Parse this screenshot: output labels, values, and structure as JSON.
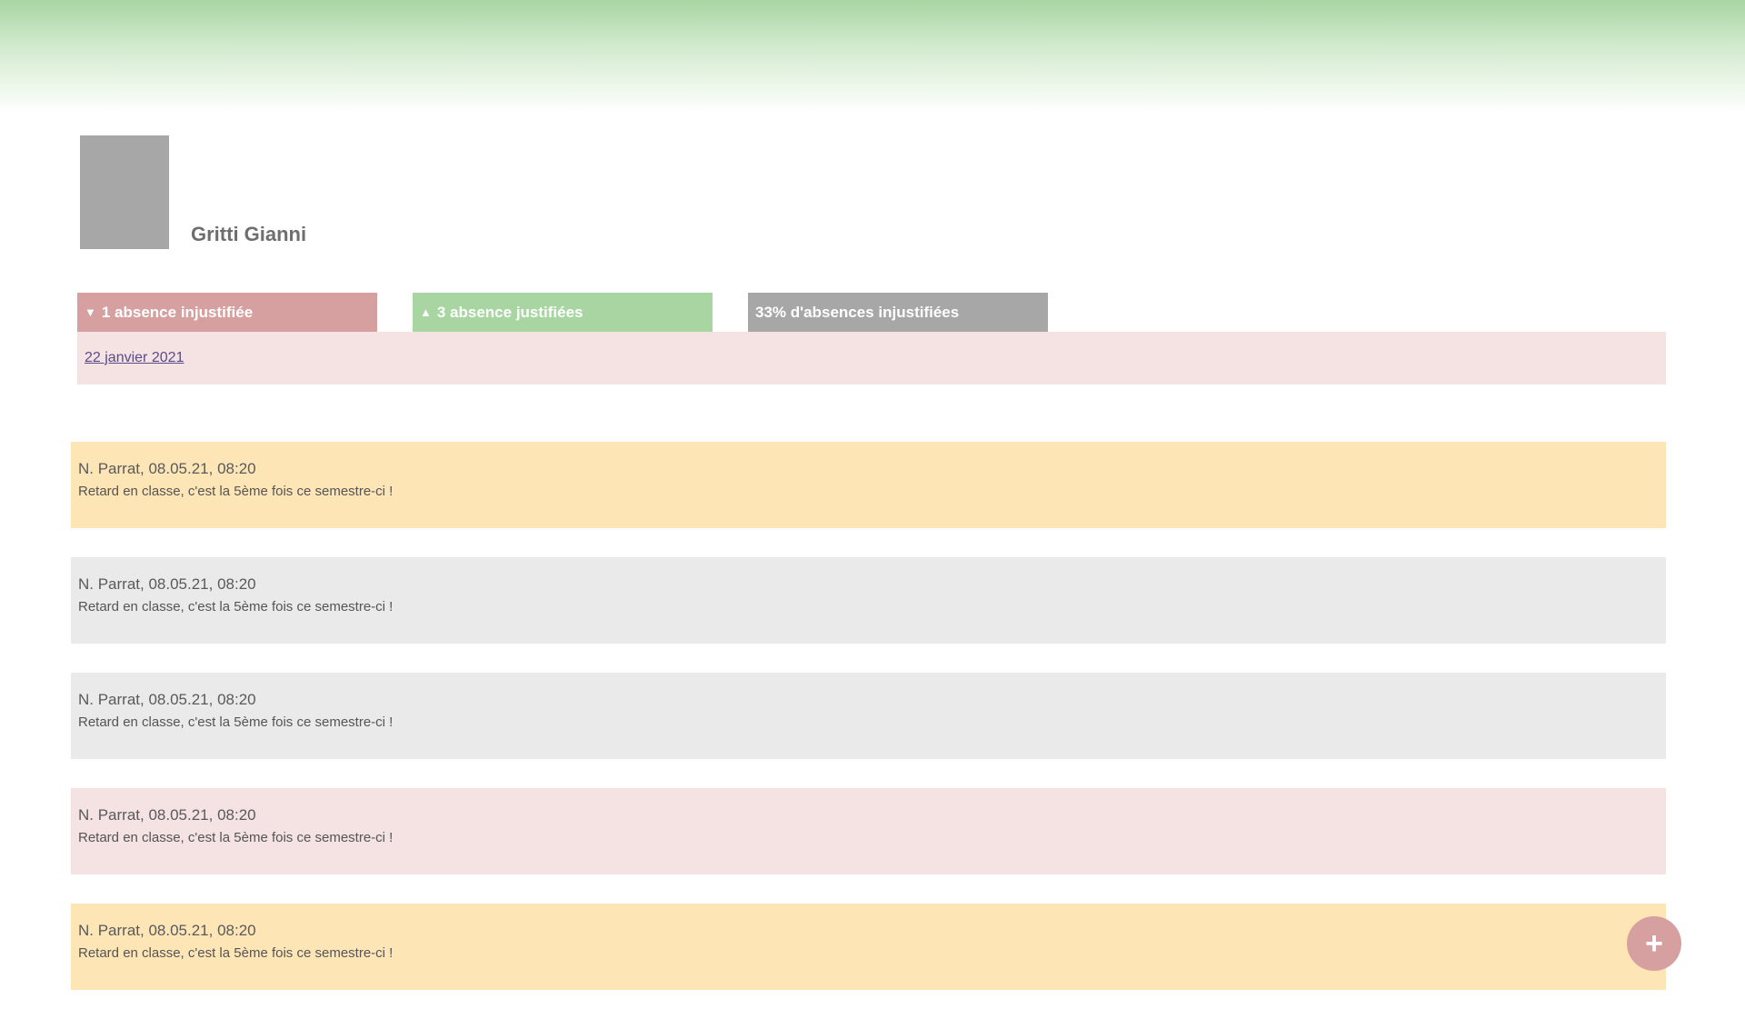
{
  "student": {
    "name": "Gritti Gianni"
  },
  "tabs": {
    "unjustified": {
      "arrow": "▼",
      "label": "1 absence injustifiée"
    },
    "justified": {
      "arrow": "▲",
      "label": "3 absence justifiées"
    },
    "stat": {
      "label": "33% d'absences injustifiées"
    }
  },
  "absences": {
    "dates": [
      "22 janvier 2021"
    ]
  },
  "notes": [
    {
      "meta": "N. Parrat, 08.05.21, 08:20",
      "text": "Retard en classe, c'est la 5ème fois ce semestre-ci !",
      "color": "#fee5b6"
    },
    {
      "meta": "N. Parrat, 08.05.21, 08:20",
      "text": "Retard en classe, c'est la 5ème fois ce semestre-ci !",
      "color": "#eaeaea"
    },
    {
      "meta": "N. Parrat, 08.05.21, 08:20",
      "text": "Retard en classe, c'est la 5ème fois ce semestre-ci !",
      "color": "#eaeaea"
    },
    {
      "meta": "N. Parrat, 08.05.21, 08:20",
      "text": "Retard en classe, c'est la 5ème fois ce semestre-ci !",
      "color": "#f5e2e2"
    },
    {
      "meta": "N. Parrat, 08.05.21, 08:20",
      "text": "Retard en classe, c'est la 5ème fois ce semestre-ci !",
      "color": "#fee5b6"
    }
  ],
  "fab": {
    "icon": "plus-icon",
    "glyph": "+"
  },
  "colors": {
    "unjustified": "#d6a0a0",
    "justified": "#a8d5a2",
    "neutral": "#a7a7a7"
  }
}
